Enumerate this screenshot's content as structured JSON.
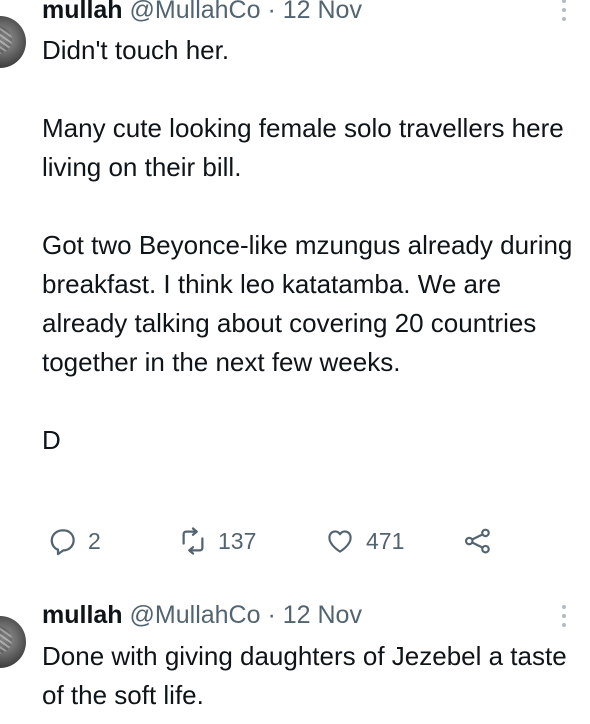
{
  "tweets": [
    {
      "name": "mullah",
      "handle": "@MullahCo",
      "separator": "·",
      "date": "12 Nov",
      "paragraphs": [
        "Didn't touch her.",
        "Many cute looking female solo travellers here living on their bill.",
        "Got two Beyonce-like mzungus already during breakfast. I think leo katatamba. We are already talking about covering 20 countries together in the next few weeks.",
        "D"
      ],
      "actions": {
        "replies": "2",
        "retweets": "137",
        "likes": "471"
      }
    },
    {
      "name": "mullah",
      "handle": "@MullahCo",
      "separator": "·",
      "date": "12 Nov",
      "paragraphs": [
        "Done with giving daughters of Jezebel a taste of the soft life."
      ]
    }
  ],
  "icons": {
    "reply": "reply-icon",
    "retweet": "retweet-icon",
    "like": "heart-icon",
    "share": "share-icon",
    "more": "more-icon"
  },
  "colors": {
    "text": "#0f1419",
    "secondary": "#536471",
    "background": "#ffffff"
  }
}
